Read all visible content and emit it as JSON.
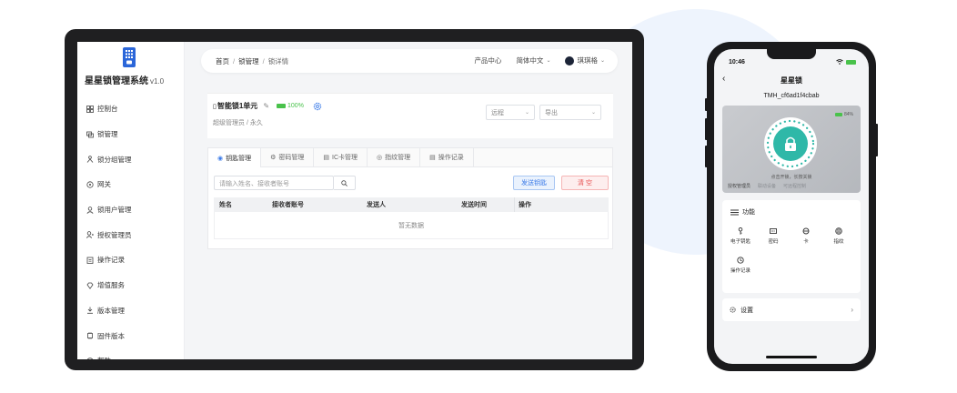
{
  "sidebar": {
    "logo_icon": "door-lock-logo-icon",
    "title": "星星锁管理系统",
    "version": "v1.0",
    "items": [
      {
        "label": "控制台",
        "icon": "dashboard-icon"
      },
      {
        "label": "锁管理",
        "icon": "lock-icon"
      },
      {
        "label": "锁分组管理",
        "icon": "group-icon"
      },
      {
        "label": "网关",
        "icon": "gateway-icon"
      },
      {
        "label": "锁用户管理",
        "icon": "user-icon"
      },
      {
        "label": "授权管理员",
        "icon": "admin-icon"
      },
      {
        "label": "操作记录",
        "icon": "record-icon"
      },
      {
        "label": "增值服务",
        "icon": "diamond-icon"
      },
      {
        "label": "版本管理",
        "icon": "version-icon"
      },
      {
        "label": "固件版本",
        "icon": "firmware-icon"
      },
      {
        "label": "帮助",
        "icon": "help-icon"
      }
    ]
  },
  "header": {
    "breadcrumb": [
      "首页",
      "锁管理",
      "锁详情"
    ],
    "product_center": "产品中心",
    "language": "简体中文",
    "username": "琪琪格"
  },
  "lock": {
    "name": "智能锁1单元",
    "battery": "100%",
    "role": "超级管理员 / 永久",
    "select_remote": "远程",
    "select_export": "导出"
  },
  "tabs": [
    "钥匙管理",
    "密码管理",
    "IC卡管理",
    "指纹管理",
    "操作记录"
  ],
  "key_table": {
    "search_placeholder": "请输入姓名、接收者账号",
    "send_button": "发送钥匙",
    "clear_button": "清 空",
    "columns": [
      "姓名",
      "接收者账号",
      "发送人",
      "发送时间",
      "操作"
    ],
    "empty_text": "暂无数据"
  },
  "phone": {
    "time": "10:46",
    "title": "星星锁",
    "device_id": "TMH_cf6ad1f4cbab",
    "battery_pct": "84%",
    "hint": "点击开锁，长按关锁",
    "footer": [
      "授权管理员",
      "联动设备",
      "可远程控制"
    ],
    "functions_title": "功能",
    "functions": [
      "电子钥匙",
      "密码",
      "卡",
      "指纹",
      "操作记录"
    ],
    "settings": "设置"
  },
  "colors": {
    "accent": "#3b7be8",
    "battery": "#49c24b",
    "danger": "#e74c4c",
    "lock_teal": "#2fb8a8"
  }
}
